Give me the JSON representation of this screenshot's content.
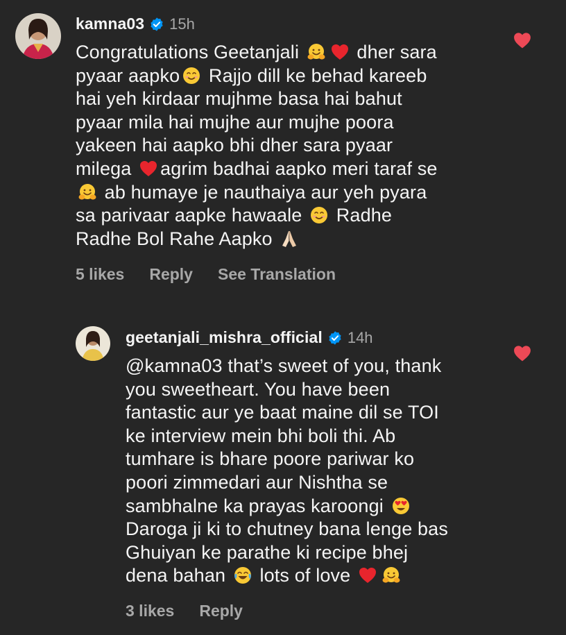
{
  "comments": [
    {
      "username": "kamna03",
      "time": "15h",
      "lines": [
        [
          "Congratulations Geetanjali ",
          "@hug",
          "@heart",
          " dher sara"
        ],
        [
          "pyaar aapko",
          "@smile",
          " Rajjo dill ke behad kareeb"
        ],
        [
          "hai yeh kirdaar mujhme basa hai bahut"
        ],
        [
          "pyaar mila hai mujhe aur mujhe poora"
        ],
        [
          "yakeen hai aapko bhi dher sara pyaar"
        ],
        [
          "milega ",
          "@heart",
          "agrim badhai aapko meri taraf se"
        ],
        [
          "@hug",
          " ab humaye je nauthaiya aur yeh pyara"
        ],
        [
          "sa parivaar aapke hawaale ",
          "@smile",
          " Radhe"
        ],
        [
          "Radhe Bol Rahe Aapko ",
          "@pray"
        ]
      ],
      "likes": "5 likes",
      "reply": "Reply",
      "translation": "See Translation"
    },
    {
      "username": "geetanjali_mishra_official",
      "time": "14h",
      "lines": [
        [
          "@kamna03 that’s sweet of you, thank"
        ],
        [
          "you sweetheart. You have been"
        ],
        [
          "fantastic aur ye baat maine dil se TOI"
        ],
        [
          "ke interview mein bhi boli thi. Ab"
        ],
        [
          "tumhare is bhare poore pariwar ko"
        ],
        [
          "poori zimmedari aur Nishtha se"
        ],
        [
          "sambhalne ka prayas karoongi ",
          "@hearteyes"
        ],
        [
          "Daroga ji ki to chutney bana lenge bas"
        ],
        [
          "Ghuiyan ke parathe ki recipe bhej"
        ],
        [
          "dena bahan ",
          "@joy",
          " lots of love ",
          "@heart",
          "@hug"
        ]
      ],
      "likes": "3 likes",
      "reply": "Reply"
    }
  ],
  "colors": {
    "background": "#262626",
    "text": "#f5f5f5",
    "muted": "#a8a8a8",
    "verified": "#0095f6",
    "heart": "#ed4956"
  },
  "icons": {
    "verified": "verified-badge-icon",
    "like": "heart-icon"
  }
}
